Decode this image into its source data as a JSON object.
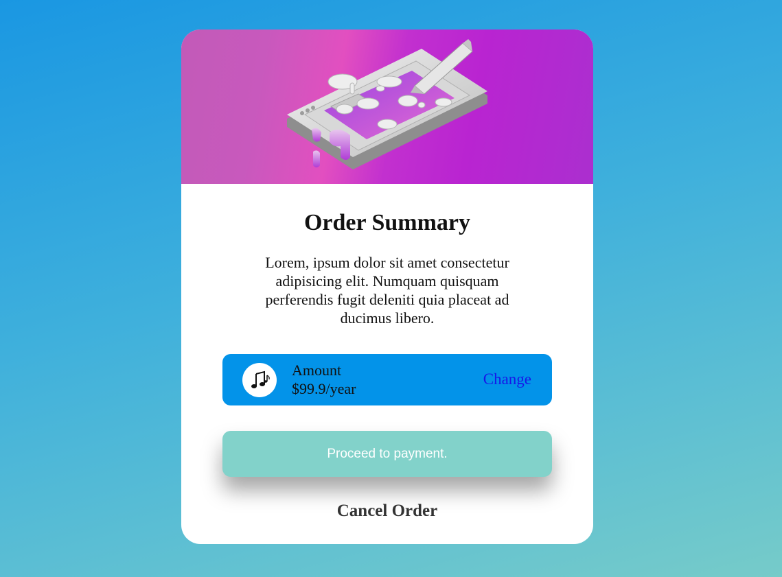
{
  "card": {
    "hero_illustration": "isometric-tablet-illustration",
    "title": "Order Summary",
    "description": "Lorem, ipsum dolor sit amet consectetur adipisicing elit. Numquam quisquam perferendis fugit deleniti quia placeat ad ducimus libero.",
    "plan": {
      "icon": "music-notes-icon",
      "label": "Amount",
      "price": "$99.9/year",
      "change_label": "Change"
    },
    "proceed_label": "Proceed to payment.",
    "cancel_label": "Cancel Order"
  },
  "colors": {
    "plan_background": "#0393e9",
    "proceed_button": "#82d2ca",
    "change_link": "#1717e8",
    "hero_gradient": [
      "#c25ab8",
      "#e24fc0",
      "#b924d1"
    ]
  }
}
